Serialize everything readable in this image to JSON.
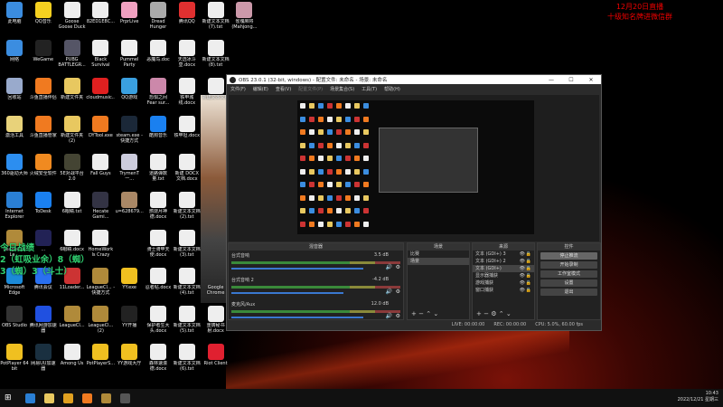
{
  "desktop": {
    "icons": [
      [
        "此电脑",
        "#3b8de0"
      ],
      [
        "网络",
        "#3b8de0"
      ],
      [
        "回收站",
        "#9ac"
      ],
      [
        "激活工具",
        "#e8d27a"
      ],
      [
        "360驱动大师",
        "#2c8ef0"
      ],
      [
        "Internet Explorer",
        "#2a7fd4"
      ],
      [
        "League of Le...",
        "#b08a3a"
      ],
      [
        "Microsoft Edge",
        "#1c8ad8"
      ],
      [
        "OBS Studio",
        "#333"
      ],
      [
        "PotPlayer 64 bit",
        "#f0c020"
      ],
      [
        "QQ音乐",
        "#f5d020"
      ],
      [
        "WeGame",
        "#222"
      ],
      [
        "斗鱼直播伴侣",
        "#f07a20"
      ],
      [
        "斗鱼直播管家",
        "#f07a20"
      ],
      [
        "火绒安全软件",
        "#f08a20"
      ],
      [
        "ToDesk",
        "#1a80f0"
      ],
      [
        "...",
        "#225"
      ],
      [
        "腾讯会议",
        "#2a70f0"
      ],
      [
        "腾讯网游加速器",
        "#2050e0"
      ],
      [
        "网易UU加速器",
        "#1a3040"
      ],
      [
        "Goose Goose Duck",
        "#eee"
      ],
      [
        "PUBG BATTLEGR...",
        "#556"
      ],
      [
        "新建文件夹",
        "#e8c860"
      ],
      [
        "新建文件夹 (2)",
        "#e8c860"
      ],
      [
        "5E对战平台 2.0",
        "#443"
      ],
      [
        "6眼睛.txt",
        "#eee"
      ],
      [
        "6眼睛.docx",
        "#eee"
      ],
      [
        "11Loader...",
        "#c33"
      ],
      [
        "LeagueCl...",
        "#b08a3a"
      ],
      [
        "Among Us",
        "#eee"
      ],
      [
        "82ED1E8C...",
        "#eee"
      ],
      [
        "Black Survival",
        "#eee"
      ],
      [
        "cloudmusic...",
        "#e02020"
      ],
      [
        "DYTool.exe",
        "#f07a20"
      ],
      [
        "Fall Guys",
        "#eee"
      ],
      [
        "Hecate Gami...",
        "#334"
      ],
      [
        "HomeWork Is Crazy",
        "#eee"
      ],
      [
        "LeagueCl... - 快捷方式",
        "#b08a3a"
      ],
      [
        "LeagueCl... (2)",
        "#b08a3a"
      ],
      [
        "PotPlayerS...",
        "#f0c020"
      ],
      [
        "PrprLive",
        "#f0a0c0"
      ],
      [
        "Pummel Party",
        "#eee"
      ],
      [
        "QQ游戏",
        "#3aa0e0"
      ],
      [
        "steam.exe - 快捷方式",
        "#1b2838"
      ],
      [
        "TrymenT 一...",
        "#ccd"
      ],
      [
        "u=628679...",
        "#a86"
      ],
      [
        "",
        "transparent"
      ],
      [
        "YY.exe",
        "#f0c020"
      ],
      [
        "YY开播",
        "#222"
      ],
      [
        "YY游戏大厅",
        "#f0c020"
      ],
      [
        "Dread Hunger",
        "#aaa"
      ],
      [
        "恶魔鸟.doc",
        "#eee"
      ],
      [
        "恐惧之间 Fear sur...",
        "#c8a"
      ],
      [
        "酷狗音乐",
        "#1a80f0"
      ],
      [
        "道路弹数量.txt",
        "#eee"
      ],
      [
        "燃烧月神德.docx",
        "#eee"
      ],
      [
        "骑士骑甲天使.docx",
        "#eee"
      ],
      [
        "忍者帖.docx",
        "#eee"
      ],
      [
        "保护者生大头.docx",
        "#eee"
      ],
      [
        "森林速滚德.docx",
        "#eee"
      ],
      [
        "腾讯QQ",
        "#e03030"
      ],
      [
        "天选冰斗皇.docx",
        "#eee"
      ],
      [
        "铁甲城线.docx",
        "#eee"
      ],
      [
        "铁甲坦.docx",
        "#eee"
      ],
      [
        "新建 DOCX 文档.docx",
        "#eee"
      ],
      [
        "新建文本文档 (2).txt",
        "#eee"
      ],
      [
        "新建文本文档 (3).txt",
        "#eee"
      ],
      [
        "新建文本文档 (4).txt",
        "#eee"
      ],
      [
        "新建文本文档 (5).txt",
        "#eee"
      ],
      [
        "新建文本文档 (6).txt",
        "#eee"
      ],
      [
        "新建文本文档 (7).txt",
        "#eee"
      ],
      [
        "新建文本文档 (8).txt",
        "#eee"
      ],
      [
        "新建文本文档",
        "#eee"
      ],
      [
        "",
        "transparent"
      ],
      [
        "",
        "transparent"
      ],
      [
        "",
        "transparent"
      ],
      [
        "",
        "transparent"
      ],
      [
        "Google Chrome",
        "transparent"
      ],
      [
        "重铸秘书射.docx",
        "#eee"
      ],
      [
        "Riot Client",
        "#e02030"
      ],
      [
        "雀魂麻将 (Mahjong...",
        "#c9a"
      ]
    ]
  },
  "overlay_red": [
    "12月20日直播",
    "十级知名牌进微信群"
  ],
  "overlay_green": [
    "今日战绩",
    "2（虹吸业余）8（蜘）",
    "3（蜘）3（斗士）"
  ],
  "obs": {
    "title": "OBS 23.0.1 (32-bit, windows) - 配置文件: 未命名 - 场景: 未命名",
    "window_buttons": [
      "—",
      "☐",
      "✕"
    ],
    "menu": [
      "文件(F)",
      "编辑(E)",
      "查看(V)",
      "配置文件(P)",
      "场景集合(S)",
      "工具(T)",
      "帮助(H)"
    ],
    "mixer": {
      "title": "混音器",
      "channels": [
        {
          "name": "台式音响",
          "db": "3.5 dB",
          "vol": 0.92
        },
        {
          "name": "台式音响 2",
          "db": "-4.2 dB",
          "vol": 0.78
        },
        {
          "name": "麦克风/Aux",
          "db": "12.0 dB",
          "vol": 0.92
        }
      ]
    },
    "scenes": {
      "title": "场景",
      "items": [
        "比赛",
        "场景"
      ],
      "selected": 1
    },
    "sources": {
      "title": "来源",
      "items": [
        "文本 (GDI+) 3",
        "文本 (GDI+) 2",
        "文本 (GDI+)",
        "显示器捕获",
        "游戏捕获",
        "窗口捕获"
      ],
      "selected": 2
    },
    "controls": {
      "title": "控件",
      "buttons": [
        "停止推流",
        "开始录制",
        "工作室模式",
        "设置",
        "退出"
      ]
    },
    "status": {
      "live": "LIVE: 00:00:00",
      "rec": "REC: 00:00:00",
      "cpu": "CPU: 5.0%, 60.00 fps"
    }
  },
  "taskbar": {
    "time": "10:43",
    "date": "2022/12/21 星期三",
    "apps": [
      "#2a7fd4",
      "#e8c860",
      "#e0a020",
      "#f07a20",
      "#b08a3a",
      "#555"
    ]
  }
}
